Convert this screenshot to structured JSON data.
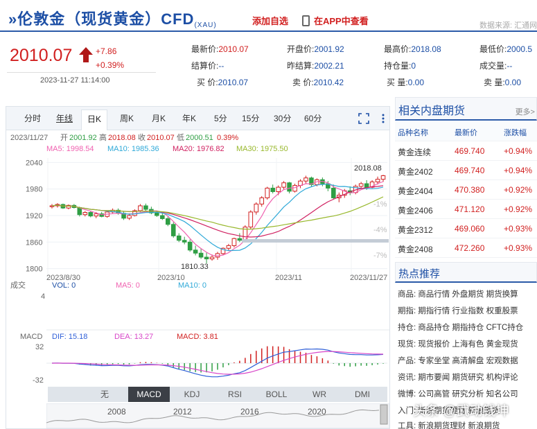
{
  "header": {
    "title": "»伦敦金（现货黄金）CFD",
    "title_sub": "(XAU)",
    "add_fav": "添加自选",
    "app_view": "在APP中查看",
    "source": "数据来源: 汇通网"
  },
  "quote": {
    "price": "2010.07",
    "change": "+7.86",
    "change_pct": "+0.39%",
    "time": "2023-11-27 11:14:00",
    "fields": {
      "latest_label": "最新价:",
      "latest": "2010.07",
      "open_label": "开盘价:",
      "open": "2001.92",
      "high_label": "最高价:",
      "high": "2018.08",
      "low_label": "最低价:",
      "low": "2000.5",
      "settle_label": "结算价:",
      "settle": "--",
      "prev_settle_label": "昨结算:",
      "prev_settle": "2002.21",
      "oi_label": "持仓量:",
      "oi": "0",
      "vol_label": "成交量:",
      "vol": "--",
      "bid_label": "买 价:",
      "bid": "2010.07",
      "ask_label": "卖 价:",
      "ask": "2010.42",
      "bid_vol_label": "买 量:",
      "bid_vol": "0.00",
      "ask_vol_label": "卖 量:",
      "ask_vol": "0.00"
    }
  },
  "chart_tabs": [
    "分时",
    "年线",
    "日K",
    "周K",
    "月K",
    "年K",
    "5分",
    "15分",
    "30分",
    "60分"
  ],
  "chart_info": {
    "date": "2023/11/27",
    "open_label": "开",
    "open": "2001.92",
    "high_label": "高",
    "high": "2018.08",
    "close_label": "收",
    "close": "2010.07",
    "low_label": "低",
    "low": "2000.51",
    "pct": "0.39%",
    "ma5": "MA5: 1998.54",
    "ma10": "MA10: 1985.36",
    "ma20": "MA20: 1976.82",
    "ma30": "MA30: 1975.50",
    "high_mark": "2018.08",
    "low_mark": "1810.33",
    "vol_label": "成交",
    "vol_val": "VOL: 0",
    "vol_ma5": "MA5: 0",
    "vol_ma10": "MA10: 0",
    "vol_axis": "4",
    "macd_label": "MACD",
    "dif": "DIF: 15.18",
    "dea": "DEA: 13.27",
    "macd": "MACD: 3.81"
  },
  "indicator_tabs": [
    "无",
    "MACD",
    "KDJ",
    "RSI",
    "BOLL",
    "WR",
    "DMI"
  ],
  "overview_years": [
    "2008",
    "2012",
    "2016",
    "2020"
  ],
  "chart_data": {
    "type": "candlestick",
    "y_ticks": [
      "2040",
      "1980",
      "1920",
      "1860",
      "1800"
    ],
    "ylim": [
      1790,
      2050
    ],
    "pct_ticks": [
      "-1%",
      "-4%",
      "-7%"
    ],
    "x_ticks": [
      "2023/8/30",
      "2023/10",
      "2023/11",
      "2023/11/27"
    ],
    "macd_ticks": [
      "32",
      "-32"
    ],
    "candles": [
      [
        1940,
        1946,
        1936,
        1942
      ],
      [
        1942,
        1948,
        1938,
        1945
      ],
      [
        1945,
        1947,
        1935,
        1937
      ],
      [
        1937,
        1945,
        1934,
        1943
      ],
      [
        1943,
        1946,
        1936,
        1938
      ],
      [
        1938,
        1940,
        1918,
        1922
      ],
      [
        1922,
        1930,
        1918,
        1927
      ],
      [
        1927,
        1931,
        1916,
        1919
      ],
      [
        1919,
        1928,
        1914,
        1924
      ],
      [
        1924,
        1928,
        1916,
        1918
      ],
      [
        1918,
        1930,
        1915,
        1928
      ],
      [
        1928,
        1936,
        1925,
        1932
      ],
      [
        1932,
        1936,
        1922,
        1925
      ],
      [
        1925,
        1929,
        1910,
        1914
      ],
      [
        1914,
        1925,
        1910,
        1920
      ],
      [
        1920,
        1934,
        1918,
        1931
      ],
      [
        1931,
        1946,
        1928,
        1942
      ],
      [
        1942,
        1947,
        1930,
        1934
      ],
      [
        1934,
        1940,
        1923,
        1926
      ],
      [
        1926,
        1930,
        1917,
        1920
      ],
      [
        1920,
        1926,
        1910,
        1913
      ],
      [
        1913,
        1918,
        1896,
        1900
      ],
      [
        1900,
        1905,
        1870,
        1874
      ],
      [
        1874,
        1880,
        1860,
        1864
      ],
      [
        1864,
        1872,
        1855,
        1860
      ],
      [
        1860,
        1866,
        1838,
        1842
      ],
      [
        1842,
        1852,
        1830,
        1835
      ],
      [
        1835,
        1845,
        1822,
        1826
      ],
      [
        1826,
        1836,
        1812,
        1822
      ],
      [
        1822,
        1832,
        1818,
        1826
      ],
      [
        1826,
        1838,
        1820,
        1834
      ],
      [
        1834,
        1848,
        1830,
        1846
      ],
      [
        1846,
        1856,
        1840,
        1852
      ],
      [
        1852,
        1870,
        1848,
        1868
      ],
      [
        1868,
        1880,
        1860,
        1864
      ],
      [
        1864,
        1898,
        1862,
        1894
      ],
      [
        1894,
        1932,
        1890,
        1928
      ],
      [
        1928,
        1950,
        1922,
        1946
      ],
      [
        1946,
        1964,
        1940,
        1960
      ],
      [
        1960,
        1985,
        1956,
        1982
      ],
      [
        1982,
        1990,
        1970,
        1974
      ],
      [
        1974,
        1988,
        1966,
        1984
      ],
      [
        1984,
        1998,
        1978,
        1994
      ],
      [
        1994,
        1996,
        1970,
        1975
      ],
      [
        1975,
        1992,
        1972,
        1988
      ],
      [
        1988,
        2002,
        1982,
        1998
      ],
      [
        1998,
        2010,
        1992,
        2005
      ],
      [
        2005,
        2008,
        1985,
        1990
      ],
      [
        1990,
        2004,
        1986,
        2001
      ],
      [
        2001,
        2006,
        1986,
        1992
      ],
      [
        1992,
        1998,
        1975,
        1982
      ],
      [
        1982,
        1990,
        1956,
        1960
      ],
      [
        1960,
        1972,
        1950,
        1966
      ],
      [
        1966,
        1980,
        1960,
        1976
      ],
      [
        1976,
        1986,
        1966,
        1972
      ],
      [
        1972,
        1990,
        1968,
        1986
      ],
      [
        1986,
        1996,
        1980,
        1992
      ],
      [
        1992,
        2000,
        1978,
        1984
      ],
      [
        1984,
        2000,
        1982,
        1996
      ],
      [
        1996,
        2008,
        1990,
        2002
      ],
      [
        2002,
        2012,
        1996,
        2010
      ]
    ]
  },
  "domestic_futures": {
    "title": "相关内盘期货",
    "more": "更多>",
    "headers": [
      "品种名称",
      "最新价",
      "涨跌幅"
    ],
    "rows": [
      {
        "name": "黄金连续",
        "price": "469.740",
        "pct": "+0.94%"
      },
      {
        "name": "黄金2402",
        "price": "469.740",
        "pct": "+0.94%"
      },
      {
        "name": "黄金2404",
        "price": "470.380",
        "pct": "+0.92%"
      },
      {
        "name": "黄金2406",
        "price": "471.120",
        "pct": "+0.92%"
      },
      {
        "name": "黄金2312",
        "price": "469.060",
        "pct": "+0.93%"
      },
      {
        "name": "黄金2408",
        "price": "472.260",
        "pct": "+0.93%"
      }
    ]
  },
  "hot": {
    "title": "热点推荐",
    "rows": [
      {
        "k": "商品:",
        "l": "商品行情 外盘期货 期货换算"
      },
      {
        "k": "期指:",
        "l": "期指行情 行业指数 权重股票"
      },
      {
        "k": "持仓:",
        "l": "商品持仓 期指持仓 CFTC持仓"
      },
      {
        "k": "现货:",
        "l": "现货报价 上海有色 黄金现货"
      },
      {
        "k": "产品:",
        "l": "专家坐堂 高清解盘 宏观数据"
      },
      {
        "k": "资讯:",
        "l": "期市要闻 期货研究 机构评论"
      },
      {
        "k": "微博:",
        "l": "公司高管 研究分析 知名公司"
      },
      {
        "k": "入门:",
        "l": "新浪期货理财 新浪期货"
      },
      {
        "k": "工具:",
        "l": "新浪期货理财 新浪期货"
      }
    ]
  },
  "watermark": "头条 @武动钱坤",
  "colors": {
    "up": "#d11f1f",
    "down": "#2f9e44",
    "brand": "#1d4fa5"
  }
}
